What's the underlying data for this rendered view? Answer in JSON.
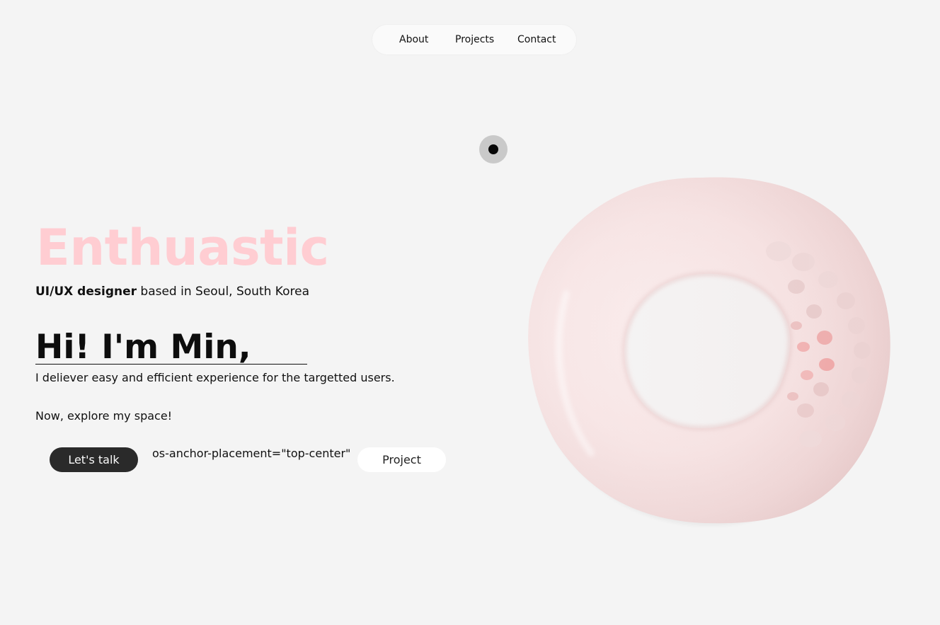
{
  "nav": {
    "items": [
      {
        "label": "About"
      },
      {
        "label": "Projects"
      },
      {
        "label": "Contact"
      }
    ]
  },
  "hero": {
    "eyebrow": "Enthuastic",
    "subtitle_bold": "UI/UX designer",
    "subtitle_rest": " based in Seoul, South Korea",
    "greeting": "Hi! I'm Min,",
    "tagline": "I deliever easy and efficient experience for the targetted users.",
    "explore": "Now, explore my space!"
  },
  "actions": {
    "talk_label": "Let's talk",
    "stray_text": "os-anchor-placement=\"top-center\"",
    "project_label": "Project"
  },
  "colors": {
    "background": "#f4f4f4",
    "accent_pink": "#ffcdd2",
    "dark_button": "#2a2a2a",
    "torus_base": "#f7e3e3",
    "torus_highlight": "#ef8f8f"
  },
  "icons": {
    "cursor": "cursor-dot-icon",
    "illustration": "torus-3d-illustration"
  }
}
